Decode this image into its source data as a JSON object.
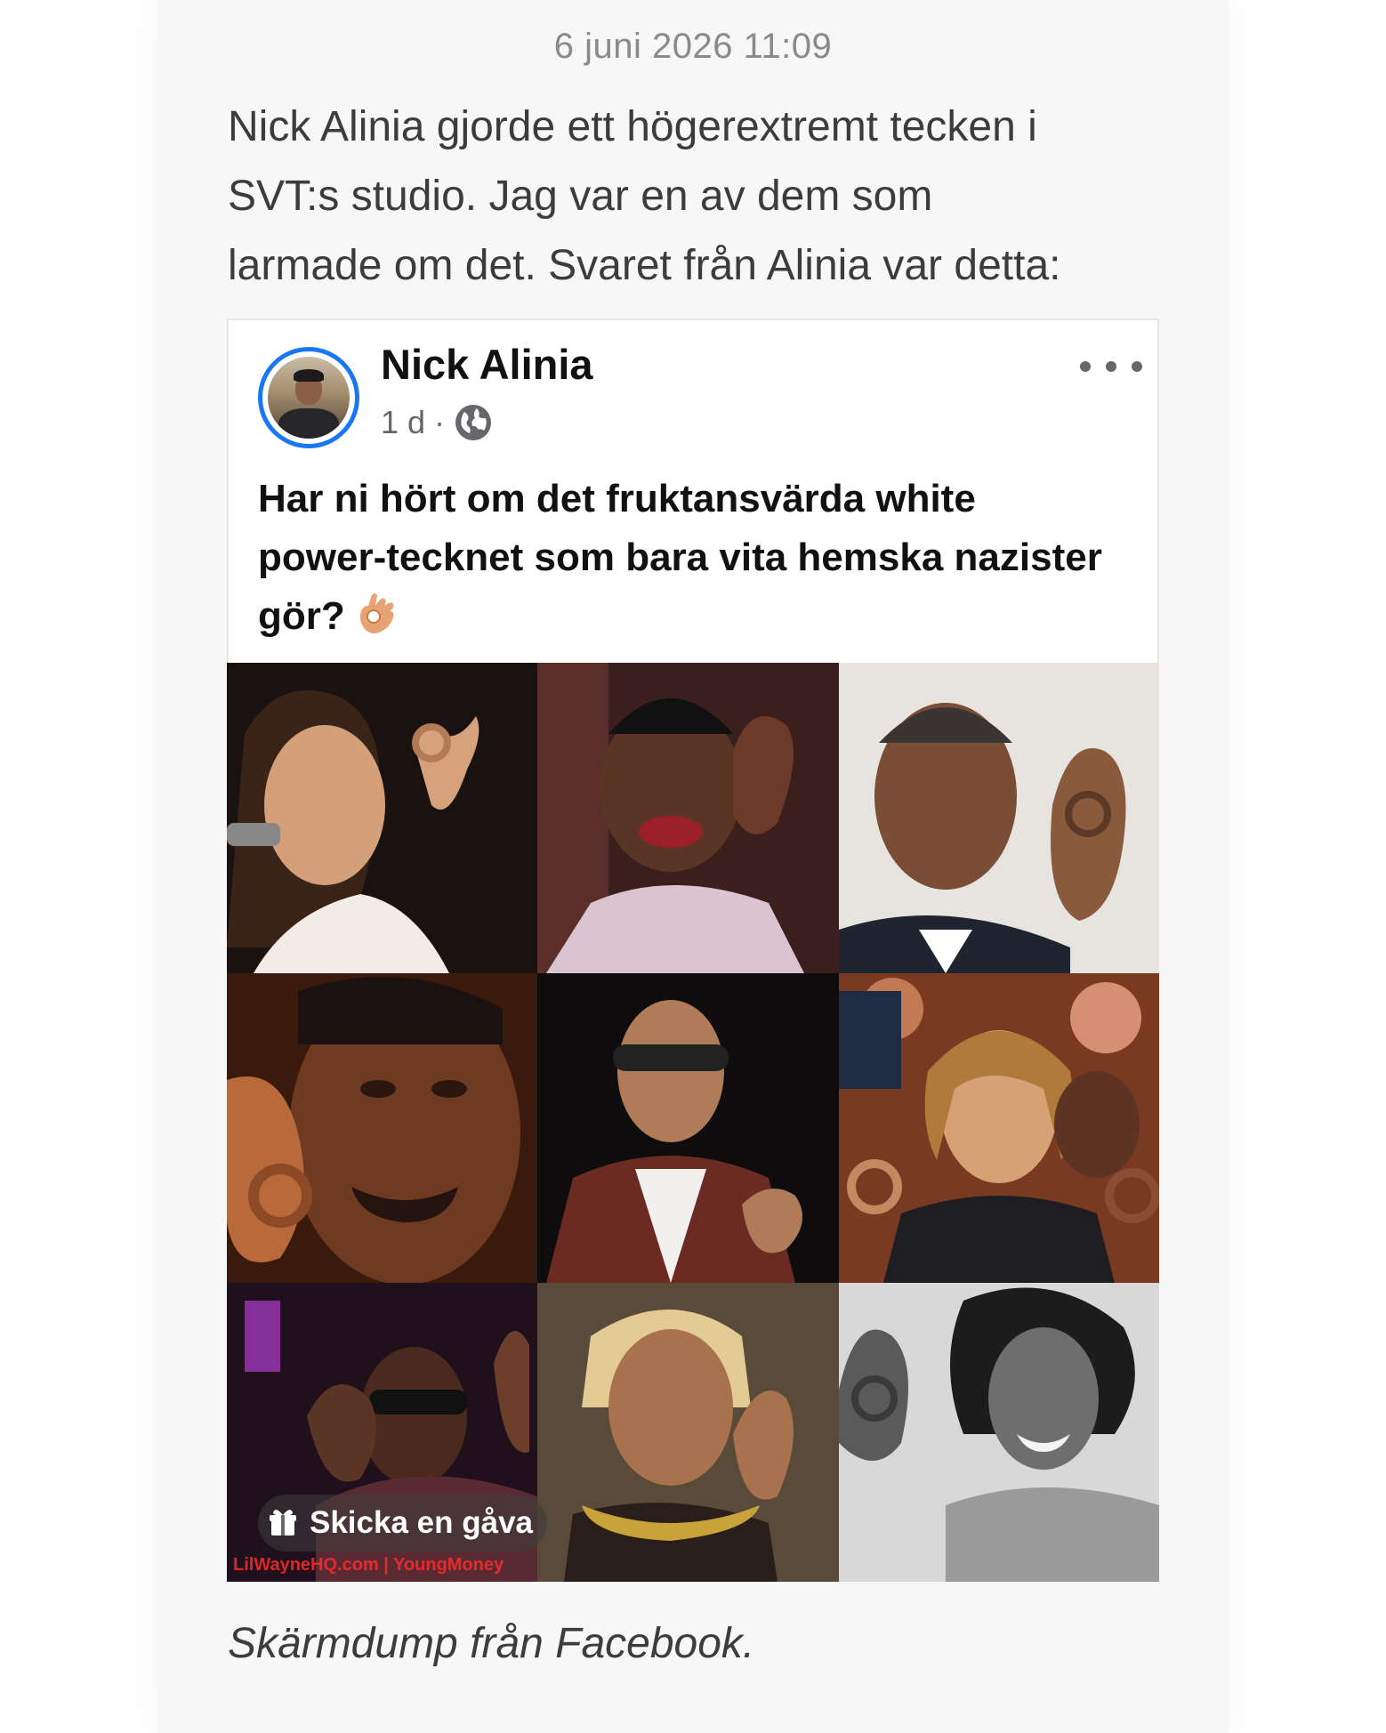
{
  "article": {
    "timestamp": "6 juni 2026 11:09",
    "paragraph_lines": [
      "Nick Alinia gjorde ett högerextremt tecken i",
      "SVT:s studio. Jag var en av dem som",
      "larmade om det. Svaret från Alinia var detta:"
    ],
    "caption": "Skärmdump från Facebook."
  },
  "facebook_post": {
    "author": "Nick Alinia",
    "age": "1 d",
    "separator": "·",
    "audience_icon": "globe-icon",
    "menu_icon": "more-options-icon",
    "text_lines": [
      "Har ni hört om det fruktansvärda white",
      "power-tecknet som bara vita hemska nazister",
      "gör?"
    ],
    "emoji": "ok-hand-emoji",
    "gift_label": "Skicka en gåva",
    "gift_icon": "gift-icon",
    "image_watermark": "LilWayneHQ.com | YoungMoney",
    "photo_count": 9
  },
  "colors": {
    "page_bg": "#f7f7f7",
    "body_text": "#3c3c3c",
    "meta_text": "#8a8a8a",
    "facebook_blue": "#1877f2"
  }
}
